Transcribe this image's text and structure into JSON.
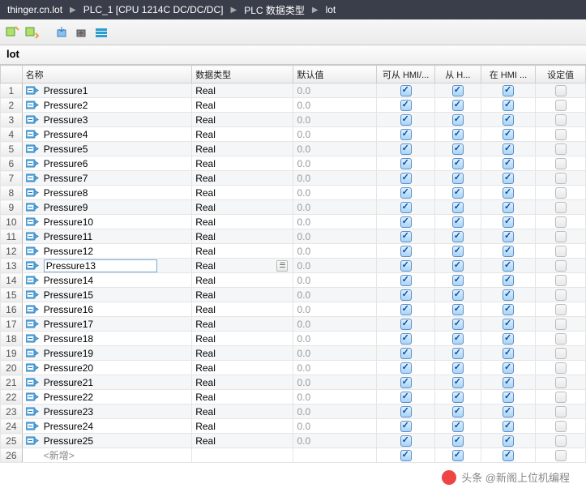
{
  "breadcrumb": [
    "thinger.cn.lot",
    "PLC_1 [CPU 1214C DC/DC/DC]",
    "PLC 数据类型",
    "lot"
  ],
  "block_title": "lot",
  "columns": {
    "rownum": "",
    "name": "名称",
    "dtype_short": "数据类型",
    "default": "默认值",
    "hmi_opc": "可从 HMI/...",
    "from_hmi": "从 H...",
    "in_hmi": "在 HMI ...",
    "setpoint": "设定值"
  },
  "selected_row": 13,
  "add_row_label": "<新增>",
  "rows": [
    {
      "n": 1,
      "name": "Pressure1",
      "dtype": "Real",
      "def": "0.0",
      "a": true,
      "b": true,
      "c": true,
      "s": false
    },
    {
      "n": 2,
      "name": "Pressure2",
      "dtype": "Real",
      "def": "0.0",
      "a": true,
      "b": true,
      "c": true,
      "s": false
    },
    {
      "n": 3,
      "name": "Pressure3",
      "dtype": "Real",
      "def": "0.0",
      "a": true,
      "b": true,
      "c": true,
      "s": false
    },
    {
      "n": 4,
      "name": "Pressure4",
      "dtype": "Real",
      "def": "0.0",
      "a": true,
      "b": true,
      "c": true,
      "s": false
    },
    {
      "n": 5,
      "name": "Pressure5",
      "dtype": "Real",
      "def": "0.0",
      "a": true,
      "b": true,
      "c": true,
      "s": false
    },
    {
      "n": 6,
      "name": "Pressure6",
      "dtype": "Real",
      "def": "0.0",
      "a": true,
      "b": true,
      "c": true,
      "s": false
    },
    {
      "n": 7,
      "name": "Pressure7",
      "dtype": "Real",
      "def": "0.0",
      "a": true,
      "b": true,
      "c": true,
      "s": false
    },
    {
      "n": 8,
      "name": "Pressure8",
      "dtype": "Real",
      "def": "0.0",
      "a": true,
      "b": true,
      "c": true,
      "s": false
    },
    {
      "n": 9,
      "name": "Pressure9",
      "dtype": "Real",
      "def": "0.0",
      "a": true,
      "b": true,
      "c": true,
      "s": false
    },
    {
      "n": 10,
      "name": "Pressure10",
      "dtype": "Real",
      "def": "0.0",
      "a": true,
      "b": true,
      "c": true,
      "s": false
    },
    {
      "n": 11,
      "name": "Pressure11",
      "dtype": "Real",
      "def": "0.0",
      "a": true,
      "b": true,
      "c": true,
      "s": false
    },
    {
      "n": 12,
      "name": "Pressure12",
      "dtype": "Real",
      "def": "0.0",
      "a": true,
      "b": true,
      "c": true,
      "s": false
    },
    {
      "n": 13,
      "name": "Pressure13",
      "dtype": "Real",
      "def": "0.0",
      "a": true,
      "b": true,
      "c": true,
      "s": false
    },
    {
      "n": 14,
      "name": "Pressure14",
      "dtype": "Real",
      "def": "0.0",
      "a": true,
      "b": true,
      "c": true,
      "s": false
    },
    {
      "n": 15,
      "name": "Pressure15",
      "dtype": "Real",
      "def": "0.0",
      "a": true,
      "b": true,
      "c": true,
      "s": false
    },
    {
      "n": 16,
      "name": "Pressure16",
      "dtype": "Real",
      "def": "0.0",
      "a": true,
      "b": true,
      "c": true,
      "s": false
    },
    {
      "n": 17,
      "name": "Pressure17",
      "dtype": "Real",
      "def": "0.0",
      "a": true,
      "b": true,
      "c": true,
      "s": false
    },
    {
      "n": 18,
      "name": "Pressure18",
      "dtype": "Real",
      "def": "0.0",
      "a": true,
      "b": true,
      "c": true,
      "s": false
    },
    {
      "n": 19,
      "name": "Pressure19",
      "dtype": "Real",
      "def": "0.0",
      "a": true,
      "b": true,
      "c": true,
      "s": false
    },
    {
      "n": 20,
      "name": "Pressure20",
      "dtype": "Real",
      "def": "0.0",
      "a": true,
      "b": true,
      "c": true,
      "s": false
    },
    {
      "n": 21,
      "name": "Pressure21",
      "dtype": "Real",
      "def": "0.0",
      "a": true,
      "b": true,
      "c": true,
      "s": false
    },
    {
      "n": 22,
      "name": "Pressure22",
      "dtype": "Real",
      "def": "0.0",
      "a": true,
      "b": true,
      "c": true,
      "s": false
    },
    {
      "n": 23,
      "name": "Pressure23",
      "dtype": "Real",
      "def": "0.0",
      "a": true,
      "b": true,
      "c": true,
      "s": false
    },
    {
      "n": 24,
      "name": "Pressure24",
      "dtype": "Real",
      "def": "0.0",
      "a": true,
      "b": true,
      "c": true,
      "s": false
    },
    {
      "n": 25,
      "name": "Pressure25",
      "dtype": "Real",
      "def": "0.0",
      "a": true,
      "b": true,
      "c": true,
      "s": false
    }
  ],
  "watermark": "头条 @新阁上位机编程"
}
